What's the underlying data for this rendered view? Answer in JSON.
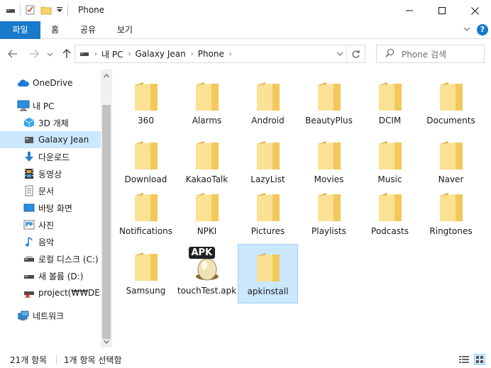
{
  "window": {
    "title": "Phone"
  },
  "ribbon": {
    "file": "파일",
    "home": "홈",
    "share": "공유",
    "view": "보기"
  },
  "address": {
    "crumbs": [
      "내 PC",
      "Galaxy Jean",
      "Phone"
    ]
  },
  "search": {
    "placeholder": "Phone 검색"
  },
  "sidebar": {
    "items": [
      {
        "label": "OneDrive",
        "icon": "cloud-icon"
      },
      {
        "label": "내 PC",
        "icon": "computer-icon"
      },
      {
        "label": "3D 개체",
        "icon": "3d-objects-icon"
      },
      {
        "label": "Galaxy Jean",
        "icon": "phone-device-icon"
      },
      {
        "label": "다운로드",
        "icon": "download-arrow-icon"
      },
      {
        "label": "동영상",
        "icon": "video-film-icon"
      },
      {
        "label": "문서",
        "icon": "document-icon"
      },
      {
        "label": "바탕 화면",
        "icon": "desktop-icon"
      },
      {
        "label": "사진",
        "icon": "pictures-icon"
      },
      {
        "label": "음악",
        "icon": "music-note-icon"
      },
      {
        "label": "로컬 디스크 (C:)",
        "icon": "drive-icon"
      },
      {
        "label": "새 볼륨 (D:)",
        "icon": "drive-icon"
      },
      {
        "label": "project(₩₩DESK",
        "icon": "network-drive-disconnected-icon"
      },
      {
        "label": "네트워크",
        "icon": "network-icon"
      }
    ]
  },
  "files": [
    {
      "name": "360",
      "type": "folder"
    },
    {
      "name": "Alarms",
      "type": "folder"
    },
    {
      "name": "Android",
      "type": "folder"
    },
    {
      "name": "BeautyPlus",
      "type": "folder"
    },
    {
      "name": "DCIM",
      "type": "folder"
    },
    {
      "name": "Documents",
      "type": "folder"
    },
    {
      "name": "Download",
      "type": "folder"
    },
    {
      "name": "KakaoTalk",
      "type": "folder"
    },
    {
      "name": "LazyList",
      "type": "folder"
    },
    {
      "name": "Movies",
      "type": "folder"
    },
    {
      "name": "Music",
      "type": "folder"
    },
    {
      "name": "Naver",
      "type": "folder"
    },
    {
      "name": "Notifications",
      "type": "folder"
    },
    {
      "name": "NPKI",
      "type": "folder"
    },
    {
      "name": "Pictures",
      "type": "folder"
    },
    {
      "name": "Playlists",
      "type": "folder"
    },
    {
      "name": "Podcasts",
      "type": "folder"
    },
    {
      "name": "Ringtones",
      "type": "folder"
    },
    {
      "name": "Samsung",
      "type": "folder"
    },
    {
      "name": "touchTest.apk",
      "type": "apk",
      "badge": "APK"
    },
    {
      "name": "apkinstall",
      "type": "folder",
      "selected": true
    }
  ],
  "status": {
    "count": "21개 항목",
    "selection": "1개 항목 선택함"
  },
  "colors": {
    "accent": "#1979ca",
    "selection": "#cce8ff",
    "folder": "#f7d36a"
  }
}
